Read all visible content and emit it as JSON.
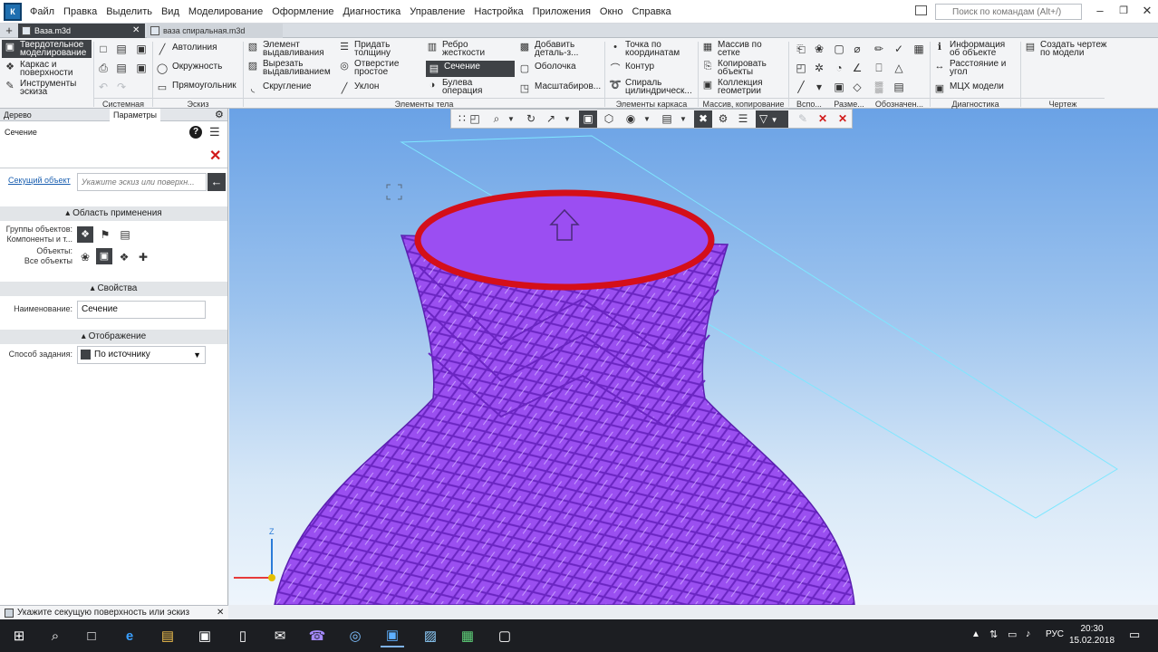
{
  "menubar": {
    "items": [
      "Файл",
      "Правка",
      "Выделить",
      "Вид",
      "Моделирование",
      "Оформление",
      "Диагностика",
      "Управление",
      "Настройка",
      "Приложения",
      "Окно",
      "Справка"
    ],
    "search_placeholder": "Поиск по командам (Alt+/)"
  },
  "doc_tabs": [
    {
      "label": "Ваза.m3d"
    },
    {
      "label": "ваза спиральная.m3d"
    }
  ],
  "ribbon": {
    "modes": {
      "solid": "Твердотельное моделирование",
      "surface": "Каркас и поверхности",
      "sketch": "Инструменты эскиза"
    },
    "sketch_tools": {
      "autoline": "Автолиния",
      "circle": "Окружность",
      "rectangle": "Прямоугольник"
    },
    "body_tools": {
      "extrude": "Элемент выдавливания",
      "cut_extrude": "Вырезать выдавливанием",
      "fillet": "Скругление",
      "thicken": "Придать толщину",
      "hole": "Отверстие простое",
      "draft": "Уклон",
      "rib": "Ребро жесткости",
      "section": "Сечение",
      "boolean": "Булева операция",
      "add_part": "Добавить деталь-з...",
      "shell": "Оболочка",
      "scale": "Масштабиров..."
    },
    "frame_tools": {
      "point": "Точка по координатам",
      "contour": "Контур",
      "helix": "Спираль цилиндрическ..."
    },
    "array_tools": {
      "grid": "Массив по сетке",
      "copy": "Копировать объекты",
      "collection": "Коллекция геометрии"
    },
    "diag_tools": {
      "info": "Информация об объекте",
      "distance": "Расстояние и угол",
      "mass": "МЦХ модели"
    },
    "drawing_tools": {
      "create_drawing": "Создать чертеж по модели"
    },
    "groups": [
      "Системная",
      "Эскиз",
      "Элементы тела",
      "Элементы каркаса",
      "Массив, копирование",
      "Вспо...",
      "Разме...",
      "Обозначен...",
      "Диагностика",
      "Чертеж"
    ]
  },
  "panel": {
    "tabs": [
      "Дерево",
      "Параметры"
    ],
    "title": "Сечение",
    "cutting_object_label": "Секущий объект",
    "cutting_object_placeholder": "Укажите эскиз или поверхн...",
    "sections": {
      "scope": "Область применения",
      "properties": "Свойства",
      "display": "Отображение"
    },
    "scope_labels": {
      "groups": "Группы объектов:",
      "components": "Компоненты и т...",
      "objects": "Объекты:",
      "all_objects": "Все объекты"
    },
    "name_label": "Наименование:",
    "name_value": "Сечение",
    "method_label": "Способ задания:",
    "method_value": "По источнику"
  },
  "status": {
    "text": "Укажите секущую поверхность или эскиз"
  },
  "viewport": {
    "axis_z": "Z"
  },
  "taskbar": {
    "lang": "РУС",
    "time": "20:30",
    "date": "15.02.2018"
  },
  "colors": {
    "model": "#9a4ff0",
    "section_rim": "#d40f1a",
    "viewport_top": "#6aa2e6",
    "viewport_bottom": "#eef5fc",
    "selected_button": "#3f4246"
  }
}
